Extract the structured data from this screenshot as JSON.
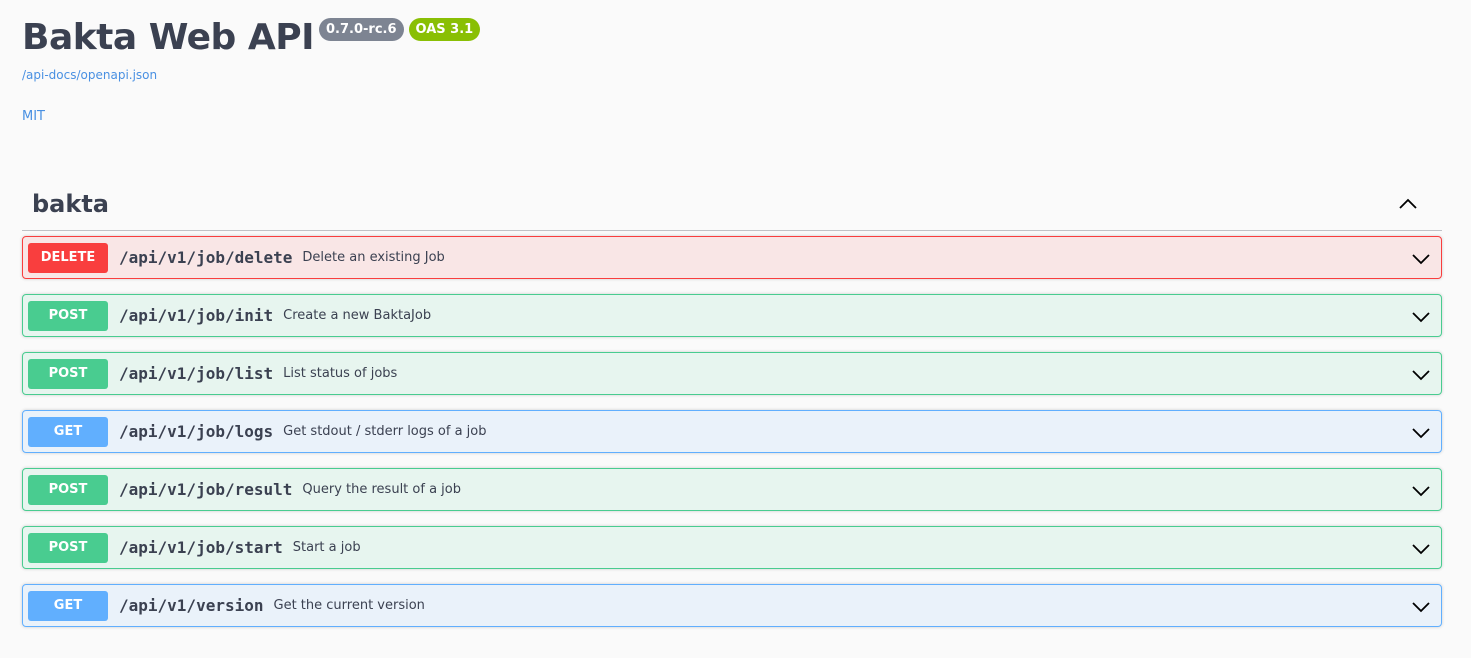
{
  "info": {
    "title": "Bakta Web API",
    "version_badge": "0.7.0-rc.6",
    "oas_badge": "OAS 3.1",
    "openapi_link": "/api-docs/openapi.json",
    "license_link": "MIT"
  },
  "tag": {
    "name": "bakta",
    "toggle_icon": "chevron-up-icon"
  },
  "operations": [
    {
      "method": "DELETE",
      "path": "/api/v1/job/delete",
      "summary": "Delete an existing Job"
    },
    {
      "method": "POST",
      "path": "/api/v1/job/init",
      "summary": "Create a new BaktaJob"
    },
    {
      "method": "POST",
      "path": "/api/v1/job/list",
      "summary": "List status of jobs"
    },
    {
      "method": "GET",
      "path": "/api/v1/job/logs",
      "summary": "Get stdout / stderr logs of a job"
    },
    {
      "method": "POST",
      "path": "/api/v1/job/result",
      "summary": "Query the result of a job"
    },
    {
      "method": "POST",
      "path": "/api/v1/job/start",
      "summary": "Start a job"
    },
    {
      "method": "GET",
      "path": "/api/v1/version",
      "summary": "Get the current version"
    }
  ],
  "colors": {
    "delete": "#f93e3e",
    "post": "#49cc90",
    "get": "#61affe",
    "link": "#4990e2",
    "text": "#3b4151"
  }
}
